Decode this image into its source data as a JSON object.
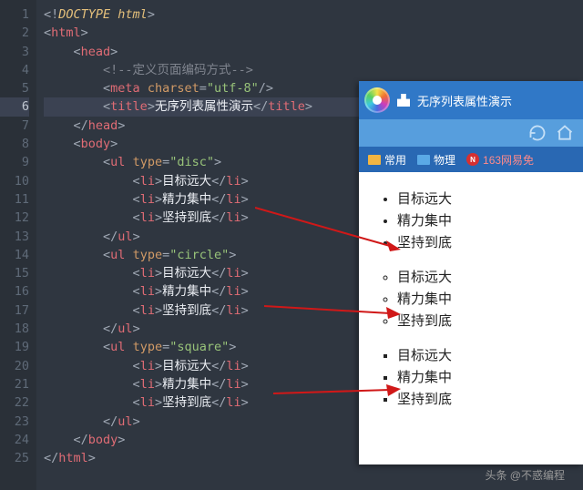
{
  "code": {
    "comment": "定义页面编码方式",
    "charset": "utf-8",
    "title": "无序列表属性演示",
    "lists": [
      {
        "type": "disc",
        "items": [
          "目标远大",
          "精力集中",
          "坚持到底"
        ]
      },
      {
        "type": "circle",
        "items": [
          "目标远大",
          "精力集中",
          "坚持到底"
        ]
      },
      {
        "type": "square",
        "items": [
          "目标远大",
          "精力集中",
          "坚持到底"
        ]
      }
    ]
  },
  "browser": {
    "tab_title": "无序列表属性演示",
    "bookmarks": [
      {
        "label": "常用"
      },
      {
        "label": "物理"
      },
      {
        "label": "163网易免"
      }
    ],
    "lists": [
      {
        "type": "disc",
        "items": [
          "目标远大",
          "精力集中",
          "坚持到底"
        ]
      },
      {
        "type": "circle",
        "items": [
          "目标远大",
          "精力集中",
          "坚持到底"
        ]
      },
      {
        "type": "square",
        "items": [
          "目标远大",
          "精力集中",
          "坚持到底"
        ]
      }
    ]
  },
  "watermark": "头条 @不惑编程",
  "lineCount": 25,
  "currentLine": 6
}
